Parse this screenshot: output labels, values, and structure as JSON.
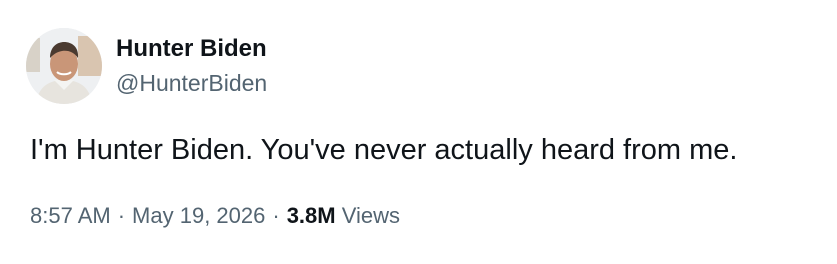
{
  "tweet": {
    "author": {
      "display_name": "Hunter Biden",
      "handle": "@HunterBiden",
      "avatar_icon": "profile-photo"
    },
    "text": "I'm Hunter Biden. You've never actually heard from me.",
    "meta": {
      "time": "8:57 AM",
      "separator": "·",
      "date": "May 19, 2026",
      "views_count": "3.8M",
      "views_label": "Views"
    }
  },
  "colors": {
    "primary_text": "#0f1419",
    "secondary_text": "#536471",
    "background": "#ffffff"
  }
}
